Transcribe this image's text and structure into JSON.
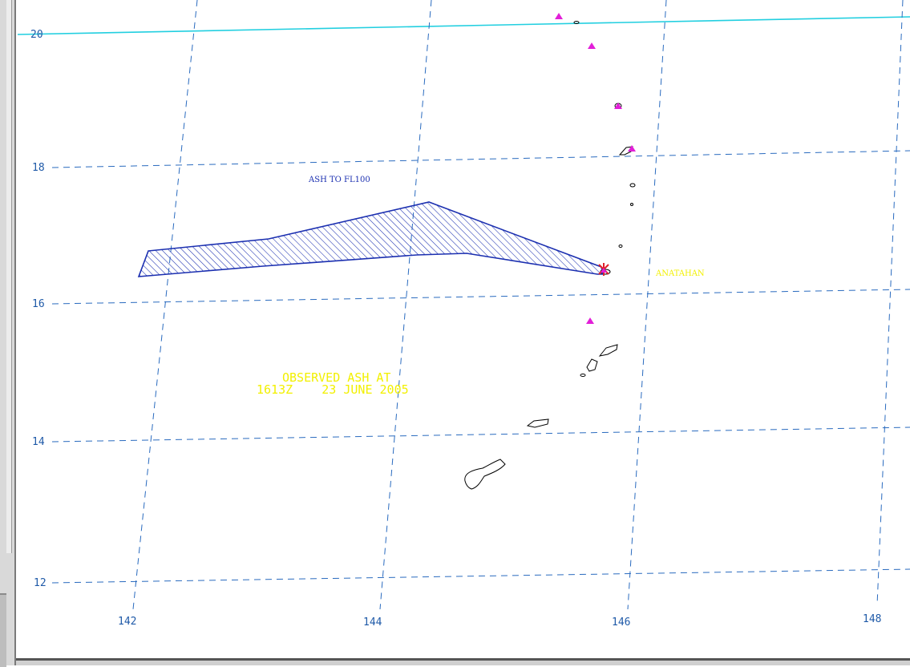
{
  "map": {
    "colors": {
      "grid": "#2a6bbf",
      "label": "#1f5aa8",
      "cyan_line": "#22cfe0",
      "coast": "#000000",
      "ash_outline": "#1b2fb0",
      "ash_hatch": "#1b2fb0",
      "volcano": "#e21fd8",
      "ann_yellow": "#f2f000",
      "ann_blue": "#1b2fb0",
      "star": "#e0202a"
    },
    "lat_labels": [
      "20",
      "18",
      "16",
      "14",
      "12"
    ],
    "lon_labels": [
      "142",
      "144",
      "146",
      "148"
    ],
    "annotations": {
      "ash_level": "ASH TO FL100",
      "volcano_name": "ANATAHAN",
      "observed_line1": "OBSERVED ASH AT",
      "observed_line2": "1613Z    23 JUNE 2005"
    },
    "icons": {
      "volcano_marker": "volcano-triangle-icon",
      "eruption_marker": "eruption-star-icon"
    }
  }
}
